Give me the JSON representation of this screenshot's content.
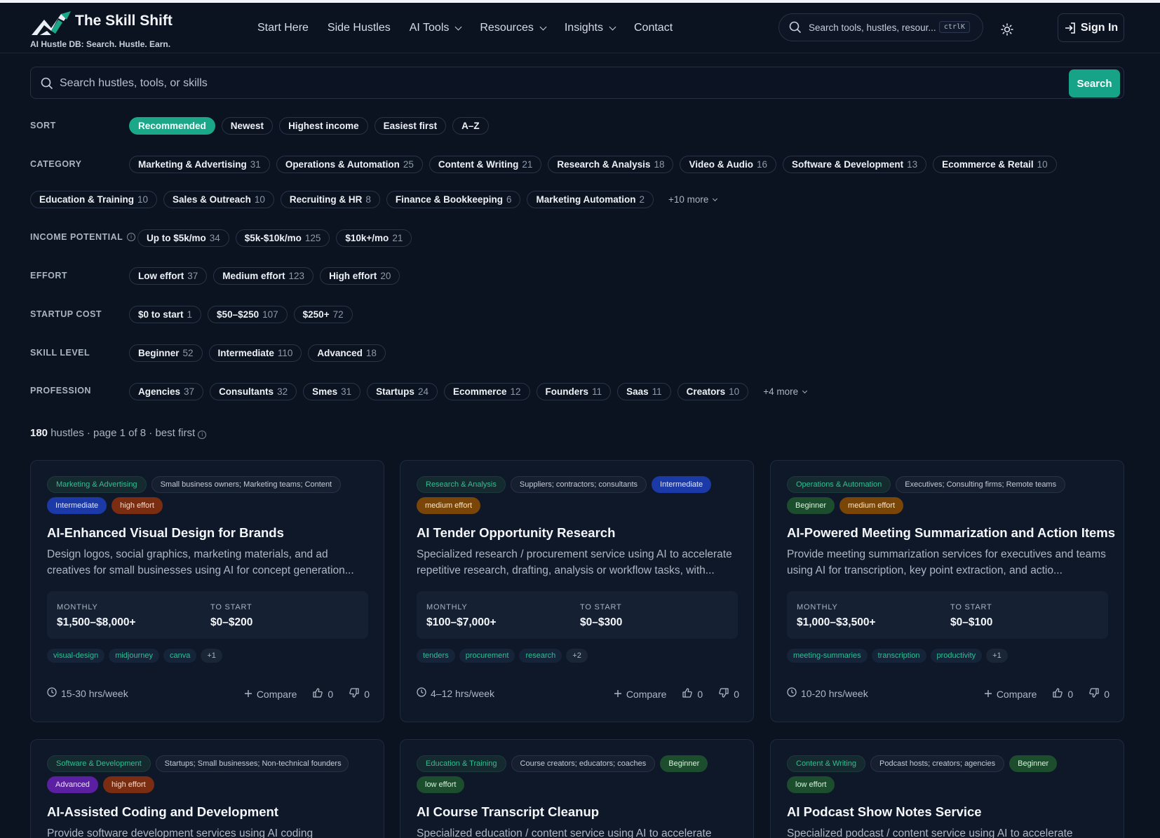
{
  "header": {
    "brand": "The Skill Shift",
    "tagline": "AI Hustle DB: Search. Hustle. Earn.",
    "nav": [
      {
        "label": "Start Here",
        "dropdown": false
      },
      {
        "label": "Side Hustles",
        "dropdown": false
      },
      {
        "label": "AI Tools",
        "dropdown": true
      },
      {
        "label": "Resources",
        "dropdown": true
      },
      {
        "label": "Insights",
        "dropdown": true
      },
      {
        "label": "Contact",
        "dropdown": false
      }
    ],
    "search_placeholder": "Search tools, hustles, resour...",
    "shortcut": "ctrlK",
    "signin_label": "Sign In"
  },
  "search": {
    "placeholder": "Search hustles, tools, or skills",
    "button_label": "Search"
  },
  "filters": {
    "sort": {
      "label": "SORT",
      "chips": [
        {
          "label": "Recommended",
          "active": true
        },
        {
          "label": "Newest"
        },
        {
          "label": "Highest income"
        },
        {
          "label": "Easiest first"
        },
        {
          "label": "A–Z"
        }
      ]
    },
    "category": {
      "label": "CATEGORY",
      "row1": [
        {
          "label": "Marketing & Advertising",
          "count": "31"
        },
        {
          "label": "Operations & Automation",
          "count": "25"
        },
        {
          "label": "Content & Writing",
          "count": "21"
        },
        {
          "label": "Research & Analysis",
          "count": "18"
        },
        {
          "label": "Video & Audio",
          "count": "16"
        },
        {
          "label": "Software & Development",
          "count": "13"
        },
        {
          "label": "Ecommerce & Retail",
          "count": "10"
        }
      ],
      "row2": [
        {
          "label": "Education & Training",
          "count": "10"
        },
        {
          "label": "Sales & Outreach",
          "count": "10"
        },
        {
          "label": "Recruiting & HR",
          "count": "8"
        },
        {
          "label": "Finance & Bookkeeping",
          "count": "6"
        },
        {
          "label": "Marketing Automation",
          "count": "2"
        }
      ],
      "more": "+10 more"
    },
    "income": {
      "label": "INCOME POTENTIAL",
      "chips": [
        {
          "label": "Up to $5k/mo",
          "count": "34"
        },
        {
          "label": "$5k-$10k/mo",
          "count": "125"
        },
        {
          "label": "$10k+/mo",
          "count": "21"
        }
      ]
    },
    "effort": {
      "label": "EFFORT",
      "chips": [
        {
          "label": "Low effort",
          "count": "37"
        },
        {
          "label": "Medium effort",
          "count": "123"
        },
        {
          "label": "High effort",
          "count": "20"
        }
      ]
    },
    "startup": {
      "label": "STARTUP COST",
      "chips": [
        {
          "label": "$0 to start",
          "count": "1"
        },
        {
          "label": "$50–$250",
          "count": "107"
        },
        {
          "label": "$250+",
          "count": "72"
        }
      ]
    },
    "skill": {
      "label": "SKILL LEVEL",
      "chips": [
        {
          "label": "Beginner",
          "count": "52"
        },
        {
          "label": "Intermediate",
          "count": "110"
        },
        {
          "label": "Advanced",
          "count": "18"
        }
      ]
    },
    "profession": {
      "label": "PROFESSION",
      "chips": [
        {
          "label": "Agencies",
          "count": "37"
        },
        {
          "label": "Consultants",
          "count": "32"
        },
        {
          "label": "Smes",
          "count": "31"
        },
        {
          "label": "Startups",
          "count": "24"
        },
        {
          "label": "Ecommerce",
          "count": "12"
        },
        {
          "label": "Founders",
          "count": "11"
        },
        {
          "label": "Saas",
          "count": "11"
        },
        {
          "label": "Creators",
          "count": "10"
        }
      ],
      "more": "+4 more"
    }
  },
  "results": {
    "count": "180",
    "text": "hustles · page 1 of 8 · best first"
  },
  "cards": [
    {
      "category": "Marketing & Advertising",
      "audience": "Small business owners; Marketing teams; Content",
      "badges": [
        {
          "label": "Intermediate",
          "kind": "int"
        },
        {
          "label": "high effort",
          "kind": "high"
        }
      ],
      "title": "AI-Enhanced Visual Design for Brands",
      "desc": "Design logos, social graphics, marketing materials, and ad creatives for small businesses using AI for concept generation...",
      "monthly_label": "MONTHLY",
      "monthly": "$1,500–$8,000+",
      "start_label": "TO START",
      "start": "$0–$200",
      "skills": [
        "visual-design",
        "midjourney",
        "canva",
        "+1"
      ],
      "hours": "15-30 hrs/week",
      "compare": "Compare",
      "up": "0",
      "down": "0"
    },
    {
      "category": "Research & Analysis",
      "audience": "Suppliers; contractors; consultants",
      "inline_badge": {
        "label": "Intermediate",
        "kind": "int"
      },
      "badges": [
        {
          "label": "medium effort",
          "kind": "med"
        }
      ],
      "title": "AI Tender Opportunity Research",
      "desc": "Specialized research / procurement service using AI to accelerate repetitive research, drafting, analysis or workflow tasks, with...",
      "monthly_label": "MONTHLY",
      "monthly": "$100–$7,000+",
      "start_label": "TO START",
      "start": "$0–$300",
      "skills": [
        "tenders",
        "procurement",
        "research",
        "+2"
      ],
      "hours": "4–12 hrs/week",
      "compare": "Compare",
      "up": "0",
      "down": "0"
    },
    {
      "category": "Operations & Automation",
      "audience": "Executives; Consulting firms; Remote teams",
      "badges": [
        {
          "label": "Beginner",
          "kind": "beg"
        },
        {
          "label": "medium effort",
          "kind": "med"
        }
      ],
      "title": "AI-Powered Meeting Summarization and Action Items",
      "desc": "Provide meeting summarization services for executives and teams using AI for transcription, key point extraction, and actio...",
      "monthly_label": "MONTHLY",
      "monthly": "$1,000–$3,500+",
      "start_label": "TO START",
      "start": "$0–$100",
      "skills": [
        "meeting-summaries",
        "transcription",
        "productivity",
        "+1"
      ],
      "hours": "10-20 hrs/week",
      "compare": "Compare",
      "up": "0",
      "down": "0"
    },
    {
      "category": "Software & Development",
      "audience": "Startups; Small businesses; Non-technical founders",
      "badges": [
        {
          "label": "Advanced",
          "kind": "adv"
        },
        {
          "label": "high effort",
          "kind": "high"
        }
      ],
      "title": "AI-Assisted Coding and Development",
      "desc": "Provide software development services using AI coding"
    },
    {
      "category": "Education & Training",
      "audience": "Course creators; educators; coaches",
      "inline_badge": {
        "label": "Beginner",
        "kind": "beg"
      },
      "badges": [
        {
          "label": "low effort",
          "kind": "low"
        }
      ],
      "title": "AI Course Transcript Cleanup",
      "desc": "Specialized education / content service using AI to accelerate"
    },
    {
      "category": "Content & Writing",
      "audience": "Podcast hosts; creators; agencies",
      "inline_badge": {
        "label": "Beginner",
        "kind": "beg"
      },
      "badges": [
        {
          "label": "low effort",
          "kind": "low"
        }
      ],
      "title": "AI Podcast Show Notes Service",
      "desc": "Specialized podcast / content service using AI to accelerate"
    }
  ],
  "colors": {
    "bg": "#0b1220",
    "accent": "#1aa889",
    "card": "#0f1829"
  }
}
